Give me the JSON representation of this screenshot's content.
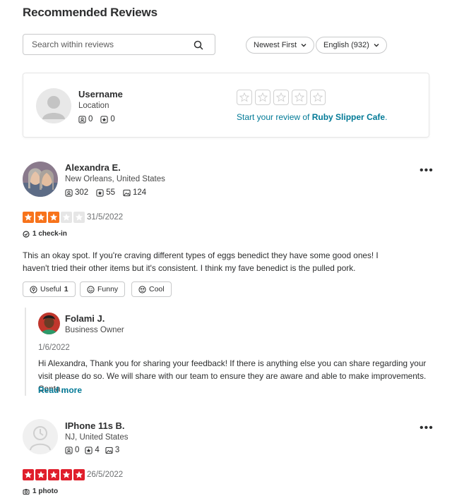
{
  "heading": "Recommended Reviews",
  "search": {
    "placeholder": "Search within reviews"
  },
  "sort": {
    "label": "Newest First"
  },
  "language": {
    "label": "English (932)"
  },
  "current_user": {
    "name": "Username",
    "location": "Location",
    "friends": "0",
    "reviews": "0",
    "prompt_prefix": "Start your review of ",
    "business": "Ruby Slipper Cafe",
    "prompt_suffix": ".",
    "rating": 0
  },
  "reviews": [
    {
      "name": "Alexandra E.",
      "location": "New Orleans, United States",
      "friends": "302",
      "reviews": "55",
      "photos": "124",
      "rating": 3,
      "rating_color": "#f7731b",
      "date": "31/5/2022",
      "tag": "1 check-in",
      "text": "This an okay spot. If you're craving different types of eggs benedict they have some good ones! I haven't tried their other items but it's consistent. I think my fave benedict is the pulled pork.",
      "buttons": {
        "useful": "Useful",
        "useful_count": "1",
        "funny": "Funny",
        "cool": "Cool"
      },
      "reply": {
        "name": "Folami J.",
        "role": "Business Owner",
        "date": "1/6/2022",
        "text": "Hi Alexandra, Thank you for sharing your feedback!  If there is anything else you can share regarding your visit please do so.  We will share with our team to ensure they are aware and able to make improvements. Conta…",
        "more": "Read more"
      }
    },
    {
      "name": "IPhone 11s B.",
      "location": "NJ, United States",
      "friends": "0",
      "reviews": "4",
      "photos": "3",
      "rating": 5,
      "rating_color": "#e01e2b",
      "date": "26/5/2022",
      "tag": "1 photo"
    }
  ],
  "more_icon": "•••"
}
